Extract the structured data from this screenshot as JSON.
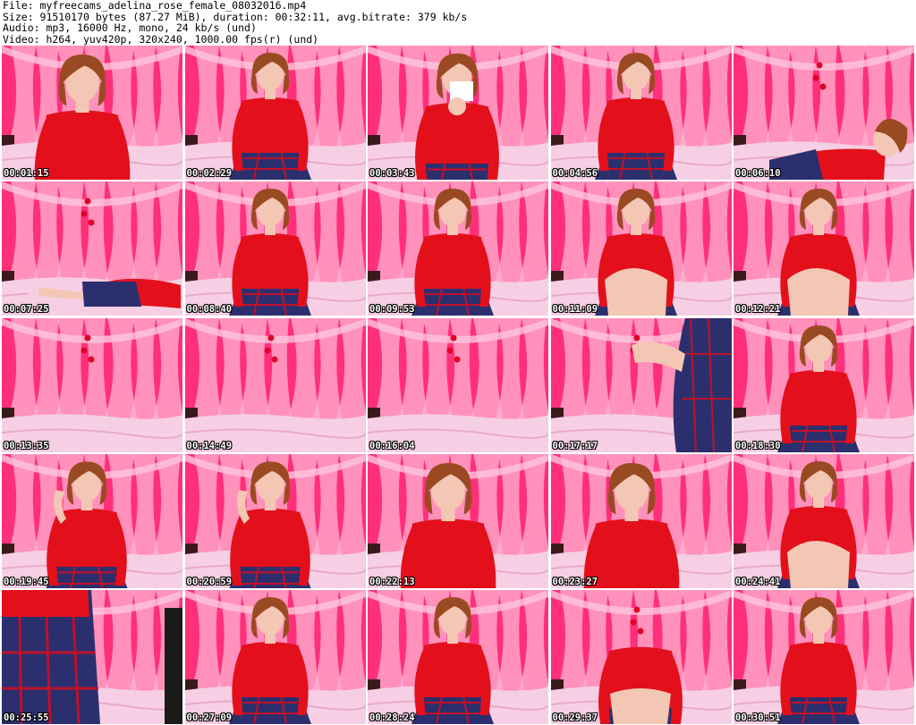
{
  "header": {
    "file_line": "File: myfreecams_adelina_rose_female_08032016.mp4",
    "size_line": "Size: 91510170 bytes (87.27 MiB), duration: 00:32:11, avg.bitrate: 379 kb/s",
    "audio_line": "Audio: mp3, 16000 Hz, mono, 24 kb/s (und)",
    "video_line": "Video: h264, yuv420p, 320x240, 1000.00 fps(r) (und)"
  },
  "colors": {
    "curtain_hot": "#ff2f7a",
    "curtain_pale": "#ffb3d1",
    "bed": "#f7cfe4",
    "dress": "#e3101c",
    "skirt": "#2b2f6e",
    "hair": "#9a4a22",
    "skin": "#f3c7b3"
  },
  "thumbnails": [
    {
      "time": "00:01:15",
      "scene": "close"
    },
    {
      "time": "00:02:29",
      "scene": "seated"
    },
    {
      "time": "00:03:43",
      "scene": "phone"
    },
    {
      "time": "00:04:56",
      "scene": "seated"
    },
    {
      "time": "00:06:10",
      "scene": "lying-right"
    },
    {
      "time": "00:07:25",
      "scene": "lying-left"
    },
    {
      "time": "00:08:40",
      "scene": "seated"
    },
    {
      "time": "00:09:53",
      "scene": "seated"
    },
    {
      "time": "00:11:09",
      "scene": "knees"
    },
    {
      "time": "00:12:21",
      "scene": "knees"
    },
    {
      "time": "00:13:35",
      "scene": "empty"
    },
    {
      "time": "00:14:49",
      "scene": "empty"
    },
    {
      "time": "00:16:04",
      "scene": "empty"
    },
    {
      "time": "00:17:17",
      "scene": "partial"
    },
    {
      "time": "00:18:30",
      "scene": "seated"
    },
    {
      "time": "00:19:45",
      "scene": "hand-hair"
    },
    {
      "time": "00:20:59",
      "scene": "hand-hair"
    },
    {
      "time": "00:22:13",
      "scene": "close"
    },
    {
      "time": "00:23:27",
      "scene": "close"
    },
    {
      "time": "00:24:41",
      "scene": "knees"
    },
    {
      "time": "00:25:55",
      "scene": "partial-skirt"
    },
    {
      "time": "00:27:09",
      "scene": "seated"
    },
    {
      "time": "00:28:24",
      "scene": "seated"
    },
    {
      "time": "00:29:37",
      "scene": "headless"
    },
    {
      "time": "00:30:51",
      "scene": "seated"
    }
  ]
}
